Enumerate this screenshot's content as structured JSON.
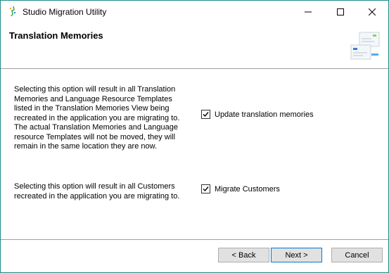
{
  "window": {
    "title": "Studio Migration Utility"
  },
  "header": {
    "title": "Translation Memories"
  },
  "sections": [
    {
      "description": "Selecting this option will result in all Translation Memories and Language Resource Templates listed in the Translation Memories View being recreated in the application you are migrating to.  The actual Translation Memories and Language resource Templates will not be moved, they will remain in the same location they are now.",
      "option_label": "Update translation memories",
      "checked": true
    },
    {
      "description": "Selecting this option will result in all Customers recreated in the application you are migrating to.",
      "option_label": "Migrate Customers",
      "checked": true
    }
  ],
  "buttons": {
    "back": "< Back",
    "next": "Next >",
    "cancel": "Cancel"
  },
  "colors": {
    "border": "#1f8b8b",
    "button_face": "#e1e1e1",
    "focus_border": "#0078d7"
  }
}
